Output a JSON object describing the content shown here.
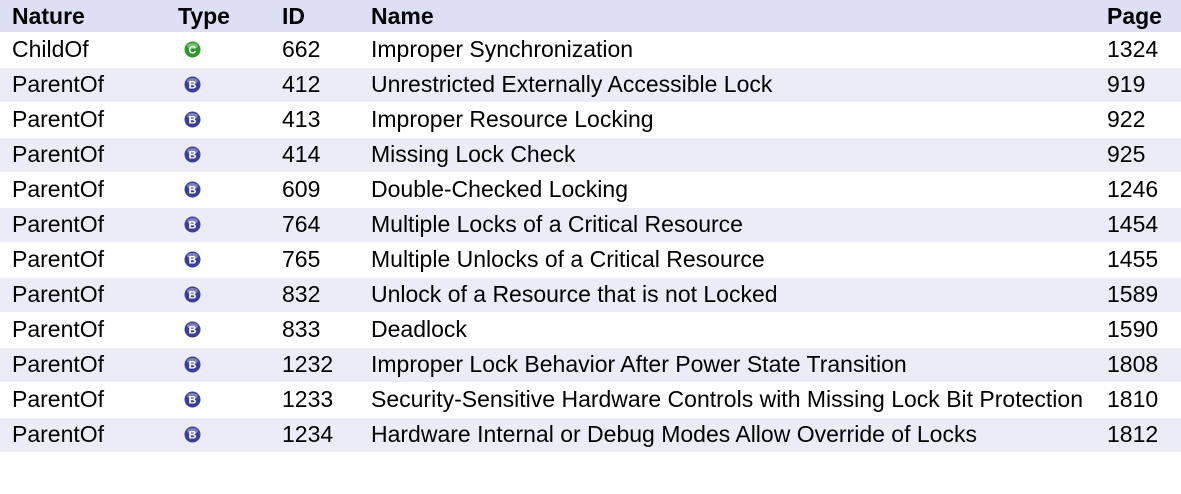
{
  "columns": {
    "nature": "Nature",
    "type": "Type",
    "id": "ID",
    "name": "Name",
    "page": "Page"
  },
  "type_colors": {
    "C": "#2e9a2e",
    "B": "#3a3f9a"
  },
  "rows": [
    {
      "nature": "ChildOf",
      "type": "C",
      "type_icon": "class-icon",
      "id": "662",
      "name": "Improper Synchronization",
      "page": "1324"
    },
    {
      "nature": "ParentOf",
      "type": "B",
      "type_icon": "base-icon",
      "id": "412",
      "name": "Unrestricted Externally Accessible Lock",
      "page": "919"
    },
    {
      "nature": "ParentOf",
      "type": "B",
      "type_icon": "base-icon",
      "id": "413",
      "name": "Improper Resource Locking",
      "page": "922"
    },
    {
      "nature": "ParentOf",
      "type": "B",
      "type_icon": "base-icon",
      "id": "414",
      "name": "Missing Lock Check",
      "page": "925"
    },
    {
      "nature": "ParentOf",
      "type": "B",
      "type_icon": "base-icon",
      "id": "609",
      "name": "Double-Checked Locking",
      "page": "1246"
    },
    {
      "nature": "ParentOf",
      "type": "B",
      "type_icon": "base-icon",
      "id": "764",
      "name": "Multiple Locks of a Critical Resource",
      "page": "1454"
    },
    {
      "nature": "ParentOf",
      "type": "B",
      "type_icon": "base-icon",
      "id": "765",
      "name": "Multiple Unlocks of a Critical Resource",
      "page": "1455"
    },
    {
      "nature": "ParentOf",
      "type": "B",
      "type_icon": "base-icon",
      "id": "832",
      "name": "Unlock of a Resource that is not Locked",
      "page": "1589"
    },
    {
      "nature": "ParentOf",
      "type": "B",
      "type_icon": "base-icon",
      "id": "833",
      "name": "Deadlock",
      "page": "1590"
    },
    {
      "nature": "ParentOf",
      "type": "B",
      "type_icon": "base-icon",
      "id": "1232",
      "name": "Improper Lock Behavior After Power State Transition",
      "page": "1808"
    },
    {
      "nature": "ParentOf",
      "type": "B",
      "type_icon": "base-icon",
      "id": "1233",
      "name": "Security-Sensitive Hardware Controls with Missing Lock Bit Protection",
      "page": "1810"
    },
    {
      "nature": "ParentOf",
      "type": "B",
      "type_icon": "base-icon",
      "id": "1234",
      "name": "Hardware Internal or Debug Modes Allow Override of Locks",
      "page": "1812"
    }
  ]
}
